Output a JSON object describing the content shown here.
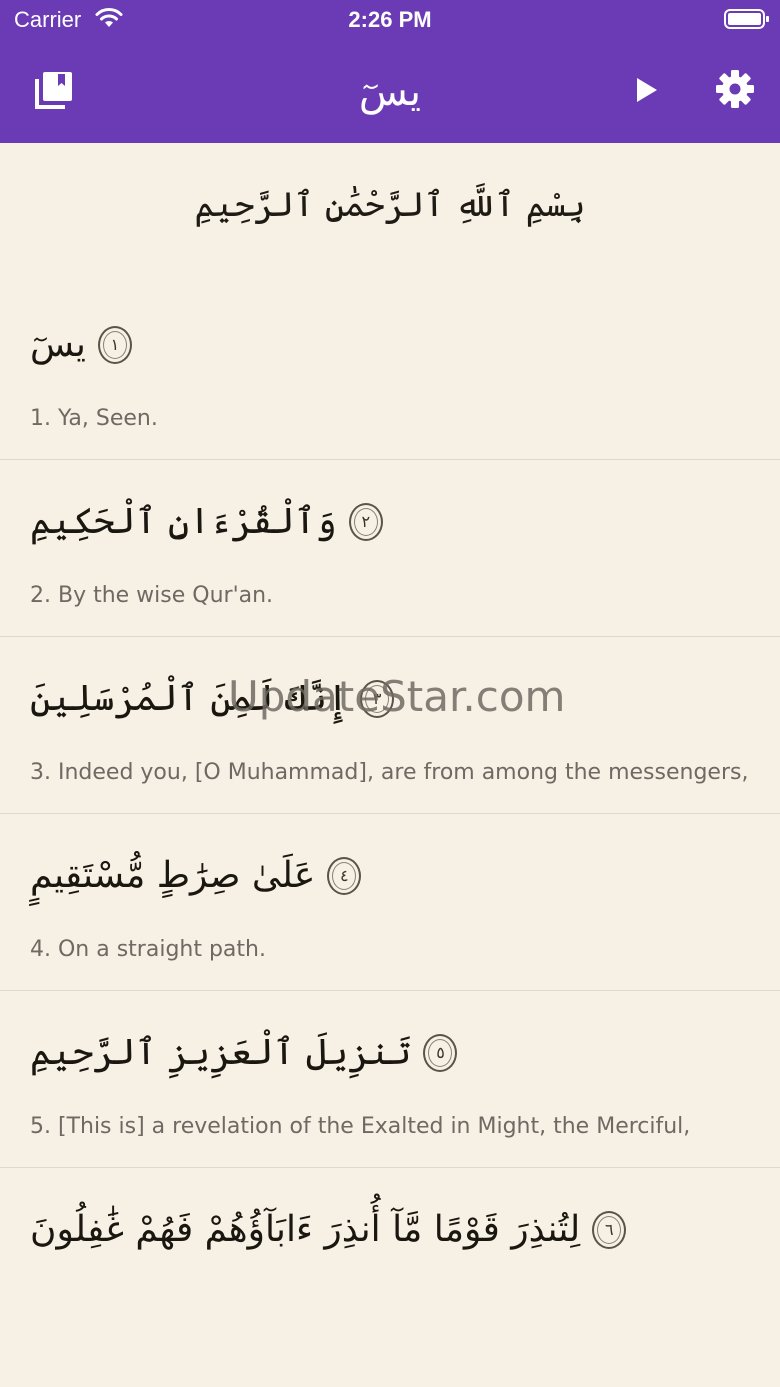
{
  "status_bar": {
    "carrier": "Carrier",
    "time": "2:26 PM"
  },
  "navbar": {
    "title": "يسٓ",
    "background_color": "#6b3bb5",
    "icons": {
      "left": "library-icon",
      "play": "play-icon",
      "settings": "gear-icon"
    }
  },
  "bismillah": "بِسْمِ ٱللَّهِ ٱلرَّحْمَٰنِ ٱلرَّحِيمِ",
  "verses": [
    {
      "number": "١",
      "arabic": "يسٓ",
      "translation": "1. Ya, Seen."
    },
    {
      "number": "٢",
      "arabic": "وَٱلْقُرْءَانِ ٱلْحَكِيمِ",
      "translation": "2. By the wise Qur'an."
    },
    {
      "number": "٣",
      "arabic": "إِنَّكَ لَمِنَ ٱلْمُرْسَلِينَ",
      "translation": "3. Indeed you, [O Muhammad], are from among the messengers,"
    },
    {
      "number": "٤",
      "arabic": "عَلَىٰ صِرَٰطٍ مُّسْتَقِيمٍ",
      "translation": "4. On a straight path."
    },
    {
      "number": "٥",
      "arabic": "تَنزِيلَ ٱلْعَزِيزِ ٱلرَّحِيمِ",
      "translation": "5. [This is] a revelation of the Exalted in Might, the Merciful,"
    },
    {
      "number": "٦",
      "arabic": "لِتُنذِرَ قَوْمًا مَّآ أُنذِرَ ءَابَآؤُهُمْ فَهُمْ غَٰفِلُونَ",
      "translation": ""
    }
  ],
  "watermark": "UpdateStar.com"
}
